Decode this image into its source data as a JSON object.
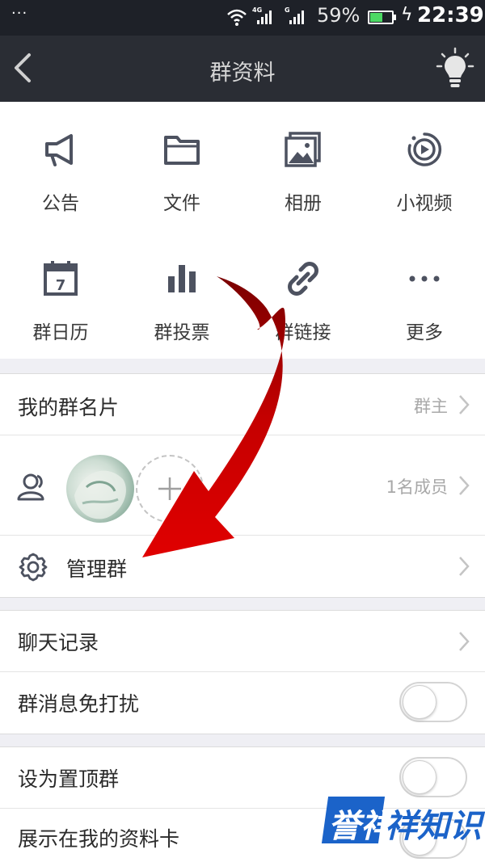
{
  "status_bar": {
    "dots": "···",
    "net1": "4G",
    "net2": "G",
    "battery_percent": "59%",
    "battery_level": 0.59,
    "time": "22:39",
    "icons": [
      "wifi-icon",
      "signal-icon",
      "battery-icon",
      "charging-icon"
    ]
  },
  "nav": {
    "title": "群资料",
    "icons": [
      "back-arrow-icon",
      "lightbulb-icon"
    ]
  },
  "features": [
    {
      "label": "公告",
      "icon": "megaphone-icon"
    },
    {
      "label": "文件",
      "icon": "folder-icon"
    },
    {
      "label": "相册",
      "icon": "photo-album-icon"
    },
    {
      "label": "小视频",
      "icon": "video-icon"
    },
    {
      "label": "群日历",
      "icon": "calendar-icon",
      "calendar_day": "7"
    },
    {
      "label": "群投票",
      "icon": "bar-chart-icon"
    },
    {
      "label": "群链接",
      "icon": "link-icon"
    },
    {
      "label": "更多",
      "icon": "more-dots-icon"
    }
  ],
  "group": {
    "card_label": "我的群名片",
    "card_value": "群主",
    "member_count": "1名成员",
    "manage_label": "管理群"
  },
  "chat": {
    "history_label": "聊天记录",
    "dnd_label": "群消息免打扰",
    "dnd_on": false
  },
  "display": {
    "pin_label": "设为置顶群",
    "pin_on": false,
    "profile_label": "展示在我的资料卡",
    "profile_on": false
  },
  "watermark": {
    "part1": "誉祥",
    "part2": "祥知识"
  },
  "colors": {
    "status_bar": "#1e2128",
    "nav_bar": "#2a2d34",
    "icon": "#4d5260",
    "arrow": "#cc0000",
    "watermark": "#1b63c9"
  }
}
